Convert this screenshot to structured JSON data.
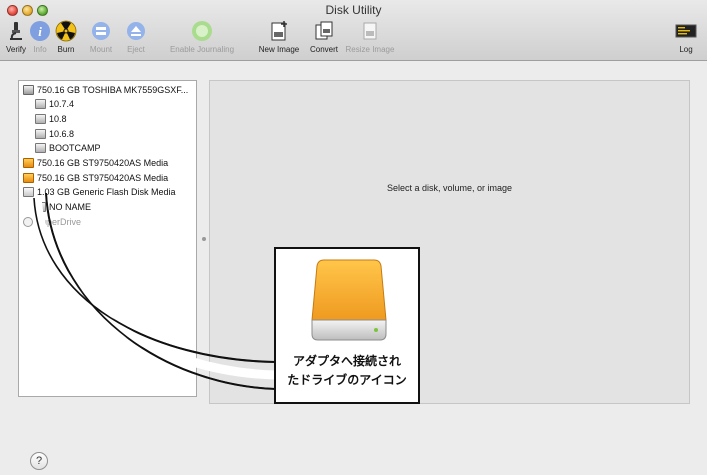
{
  "window": {
    "title": "Disk Utility"
  },
  "toolbar": {
    "items": [
      {
        "label": "Verify",
        "enabled": true
      },
      {
        "label": "Info",
        "enabled": false
      },
      {
        "label": "Burn",
        "enabled": true
      },
      {
        "label": "Mount",
        "enabled": false
      },
      {
        "label": "Eject",
        "enabled": false
      },
      {
        "label": "Enable Journaling",
        "enabled": false
      },
      {
        "label": "New Image",
        "enabled": true
      },
      {
        "label": "Convert",
        "enabled": true
      },
      {
        "label": "Resize Image",
        "enabled": false
      }
    ],
    "log_label": "Log"
  },
  "sidebar": {
    "items": [
      {
        "label": "750.16 GB TOSHIBA MK7559GSXF...",
        "icon": "internal-disk-icon"
      },
      {
        "label": "10.7.4",
        "icon": "volume-icon"
      },
      {
        "label": "10.8",
        "icon": "volume-icon"
      },
      {
        "label": "10.6.8",
        "icon": "volume-icon"
      },
      {
        "label": "BOOTCAMP",
        "icon": "volume-icon"
      },
      {
        "label": "750.16 GB ST9750420AS Media",
        "icon": "external-disk-icon"
      },
      {
        "label": "750.16 GB ST9750420AS Media",
        "icon": "external-disk-icon"
      },
      {
        "label": "1.03 GB Generic Flash Disk Media",
        "icon": "flash-disk-icon"
      },
      {
        "label": "NO NAME",
        "icon": "volume-icon"
      },
      {
        "label": "SuperDrive",
        "icon": "optical-drive-icon"
      }
    ]
  },
  "main": {
    "message": "Select a disk, volume, or image"
  },
  "help": {
    "label": "?"
  },
  "callout": {
    "line1": "アダプタへ接続され",
    "line2": "たドライブのアイコン"
  },
  "colors": {
    "drive_orange": "#f0a030",
    "callout_border": "#111111"
  }
}
